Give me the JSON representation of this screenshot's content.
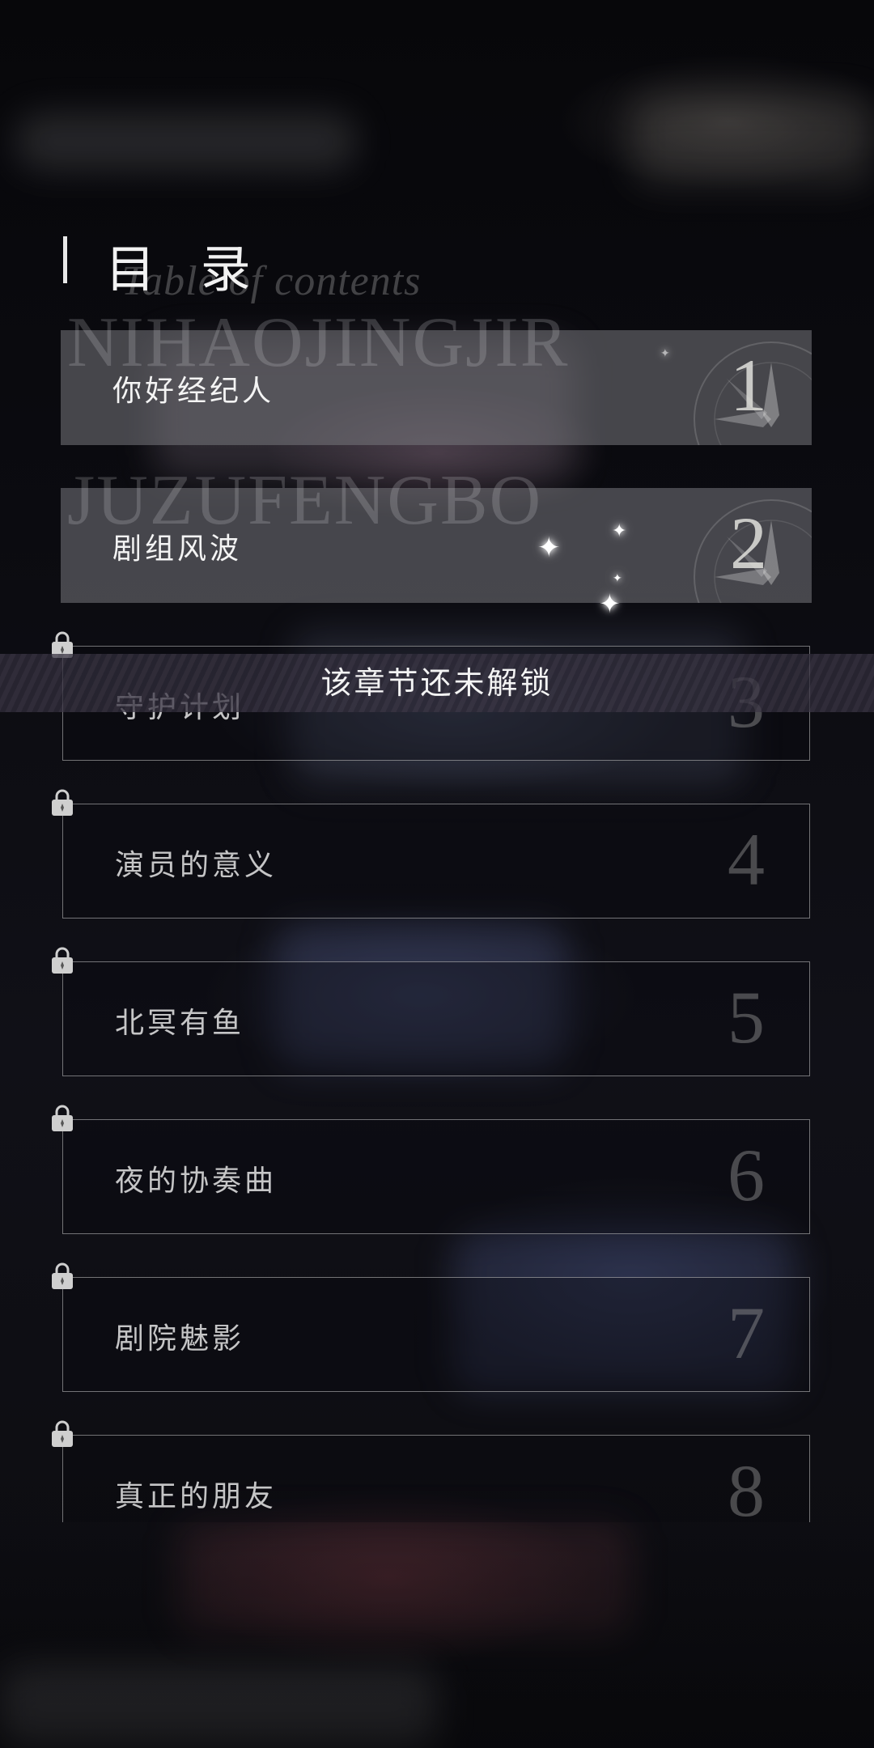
{
  "header": {
    "title": "目 录",
    "subtitle_script": "Table of contents"
  },
  "toast": {
    "message": "该章节还未解锁"
  },
  "chapters": [
    {
      "number": "1",
      "title": "你好经纪人",
      "bg_word": "NIHAOJINGJIR",
      "locked": false
    },
    {
      "number": "2",
      "title": "剧组风波",
      "bg_word": "JUZUFENGBO",
      "locked": false
    },
    {
      "number": "3",
      "title": "守护计划",
      "locked": true
    },
    {
      "number": "4",
      "title": "演员的意义",
      "locked": true
    },
    {
      "number": "5",
      "title": "北冥有鱼",
      "locked": true
    },
    {
      "number": "6",
      "title": "夜的协奏曲",
      "locked": true
    },
    {
      "number": "7",
      "title": "剧院魅影",
      "locked": true
    },
    {
      "number": "8",
      "title": "真正的朋友",
      "locked": true
    }
  ],
  "icons": {
    "lock": "lock-icon",
    "emblem": "compass-leaf-emblem-icon",
    "sparkle": "sparkle-icon"
  },
  "colors": {
    "background": "#050507",
    "unlocked_card": "#78787d",
    "locked_border": "#c8c8c8",
    "text": "#f4f4f4"
  }
}
